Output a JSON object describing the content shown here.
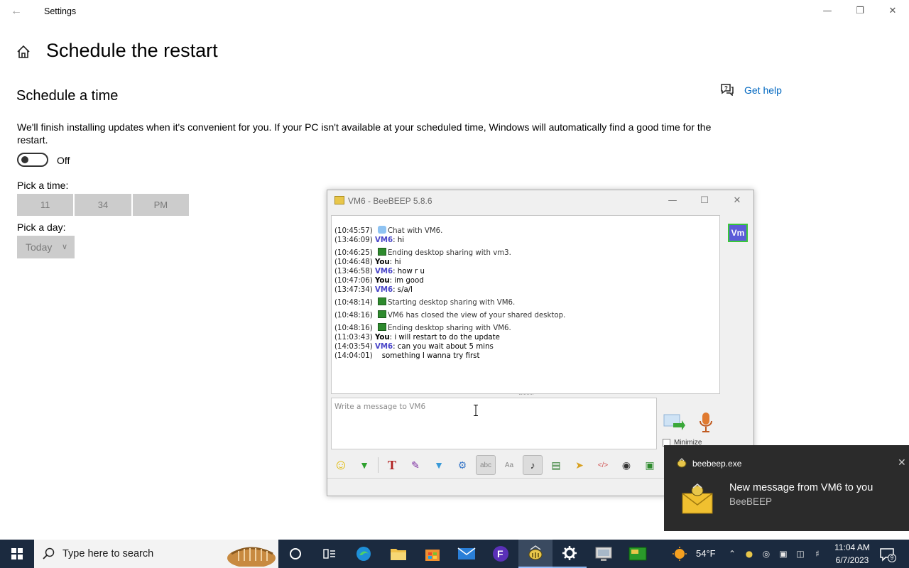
{
  "settings": {
    "window_title": "Settings",
    "page_title": "Schedule the restart",
    "section_title": "Schedule a time",
    "description": "We'll finish installing updates when it's convenient for you. If your PC isn't available at your scheduled time, Windows will automatically find a good time for the restart.",
    "toggle_state": "Off",
    "pick_time_label": "Pick a time:",
    "time": {
      "hour": "11",
      "minute": "34",
      "period": "PM"
    },
    "pick_day_label": "Pick a day:",
    "day": "Today",
    "help_label": "Get help"
  },
  "beebeep": {
    "window_title": "VM6 - BeeBEEP 5.8.6",
    "chat": [
      {
        "ts": "(10:45:57)",
        "type": "system",
        "icon": "chat-bubble-icon",
        "text": "Chat with VM6."
      },
      {
        "ts": "(13:46:09)",
        "type": "msg",
        "who": "VM6",
        "text": "hi"
      },
      {
        "ts": "(10:46:25)",
        "type": "system",
        "icon": "screen-share-icon",
        "text": "Ending desktop sharing with vm3."
      },
      {
        "ts": "(10:46:48)",
        "type": "msg",
        "who": "You",
        "text": "hi"
      },
      {
        "ts": "(13:46:58)",
        "type": "msg",
        "who": "VM6",
        "text": "how r u"
      },
      {
        "ts": "(10:47:06)",
        "type": "msg",
        "who": "You",
        "text": "im good"
      },
      {
        "ts": "(13:47:34)",
        "type": "msg",
        "who": "VM6",
        "text": "s/a/l"
      },
      {
        "ts": "(10:48:14)",
        "type": "system",
        "icon": "screen-share-icon",
        "text": "Starting desktop sharing with VM6."
      },
      {
        "ts": "(10:48:16)",
        "type": "system",
        "icon": "screen-share-icon",
        "text": "VM6 has closed the view of your shared desktop."
      },
      {
        "ts": "(10:48:16)",
        "type": "system",
        "icon": "screen-share-icon",
        "text": "Ending desktop sharing with VM6."
      },
      {
        "ts": "(11:03:43)",
        "type": "msg",
        "who": "You",
        "text": "i will restart to do the update"
      },
      {
        "ts": "(14:03:54)",
        "type": "msg",
        "who": "VM6",
        "text": "can you wait about 5 mins"
      },
      {
        "ts": "(14:04:01)",
        "type": "cont",
        "who": "",
        "text": "something I wanna try first"
      }
    ],
    "input_placeholder": "Write a message to VM6",
    "minimize_label": "Minimize",
    "user_avatar": "Vm",
    "colors": {
      "vm_name": "#4a46c8",
      "avatar_bg": "#5c5cd8",
      "avatar_border": "#38c838"
    }
  },
  "toast": {
    "app": "beebeep.exe",
    "title": "New message from VM6 to you",
    "subtitle": "BeeBEEP"
  },
  "taskbar": {
    "search_placeholder": "Type here to search",
    "temperature": "54°F",
    "time": "11:04 AM",
    "date": "6/7/2023",
    "notification_count": "9"
  }
}
